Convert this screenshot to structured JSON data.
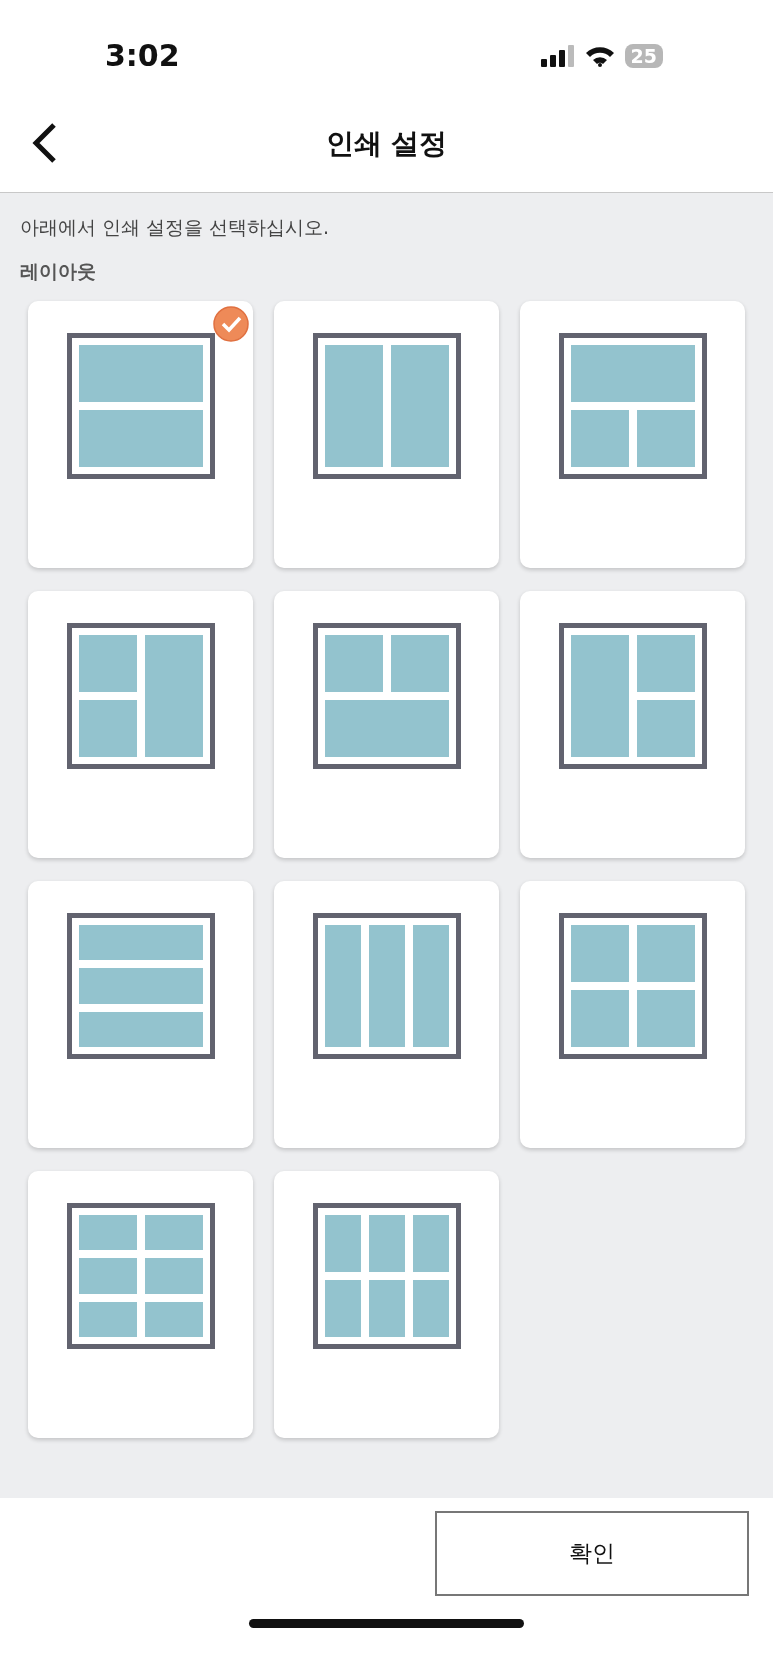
{
  "status_bar": {
    "time": "3:02",
    "battery": "25"
  },
  "header": {
    "title": "인쇄 설정"
  },
  "instruction": "아래에서 인쇄 설정을 선택하십시오.",
  "section_label": "레이아웃",
  "layouts": [
    {
      "kind": "rows2",
      "selected": true
    },
    {
      "kind": "cols2",
      "selected": false
    },
    {
      "kind": "topwide",
      "selected": false
    },
    {
      "kind": "righttall",
      "selected": false
    },
    {
      "kind": "bottomwide",
      "selected": false
    },
    {
      "kind": "lefttall",
      "selected": false
    },
    {
      "kind": "rows3",
      "selected": false
    },
    {
      "kind": "cols3",
      "selected": false
    },
    {
      "kind": "grid4",
      "selected": false
    },
    {
      "kind": "grid3x2",
      "selected": false
    },
    {
      "kind": "grid2x3",
      "selected": false
    }
  ],
  "confirm_button": "확인"
}
